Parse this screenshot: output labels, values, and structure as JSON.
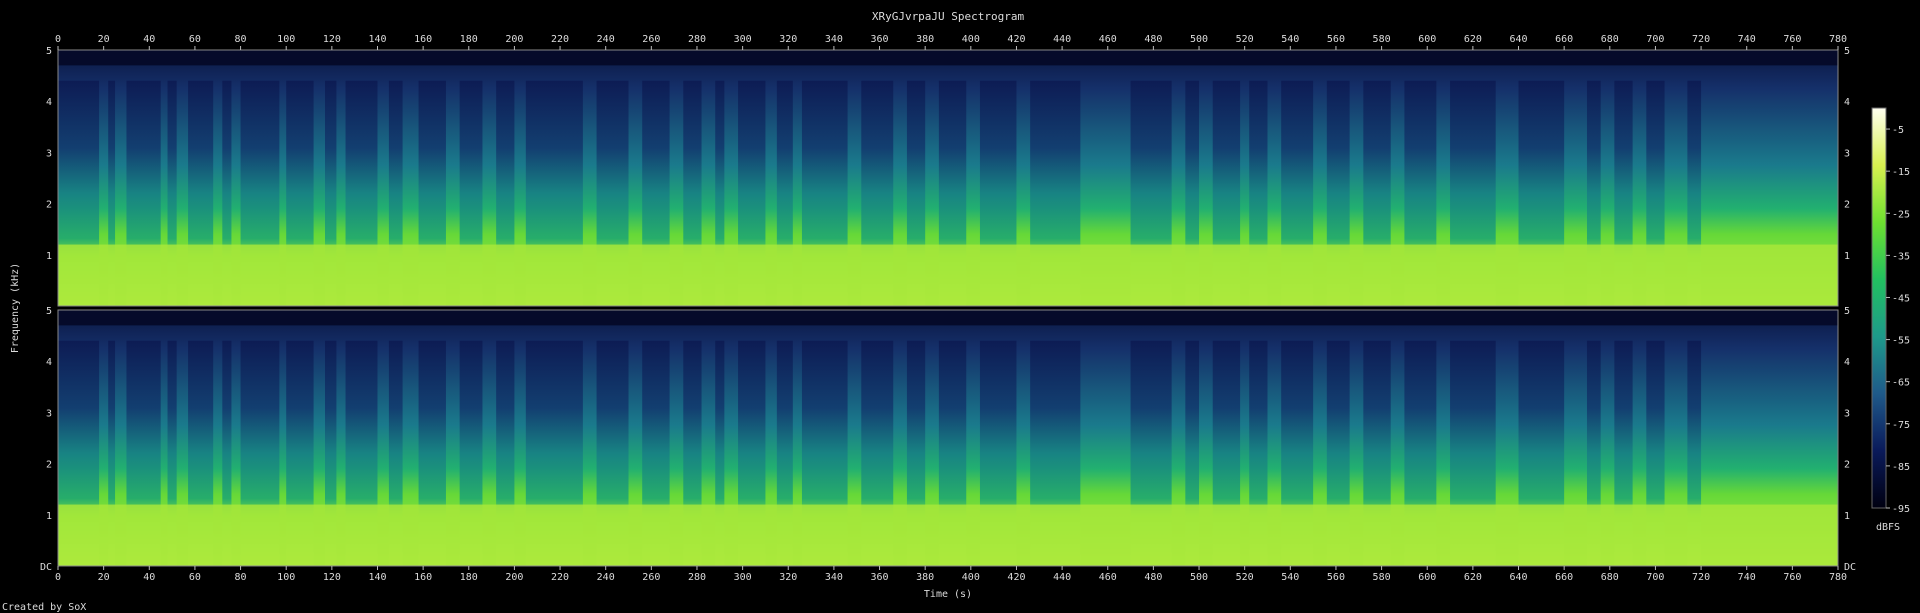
{
  "chart_data": {
    "type": "heatmap",
    "title": "XRyGJvrpaJU Spectrogram",
    "xlabel": "Time (s)",
    "ylabel": "Frequency (kHz)",
    "xlim": [
      0,
      780
    ],
    "ylim": [
      0,
      5
    ],
    "x_ticks": [
      "0",
      "20",
      "40",
      "60",
      "80",
      "100",
      "120",
      "140",
      "160",
      "180",
      "200",
      "220",
      "240",
      "260",
      "280",
      "300",
      "320",
      "340",
      "360",
      "380",
      "400",
      "420",
      "440",
      "460",
      "480",
      "500",
      "520",
      "540",
      "560",
      "580",
      "600",
      "620",
      "640",
      "660",
      "680",
      "700",
      "720",
      "740",
      "760",
      "780"
    ],
    "y_ticks_channel_top": [
      "5",
      "4",
      "3",
      "2",
      "1"
    ],
    "y_ticks_channel_bottom": [
      "5",
      "4",
      "3",
      "2",
      "1",
      "DC"
    ],
    "channels": 2,
    "colorbar": {
      "label": "dBFS",
      "ticks": [
        "-5",
        "-15",
        "-25",
        "-35",
        "-45",
        "-55",
        "-65",
        "-75",
        "-85",
        "-95"
      ],
      "range": [
        -95,
        0
      ],
      "stops": [
        "#000010",
        "#0a1a5a",
        "#1f5a8a",
        "#1e9a8a",
        "#22c060",
        "#6ee030",
        "#d8f050",
        "#fffff0"
      ]
    },
    "speech_segments_s": [
      [
        0,
        18
      ],
      [
        22,
        25
      ],
      [
        30,
        45
      ],
      [
        48,
        52
      ],
      [
        57,
        68
      ],
      [
        72,
        76
      ],
      [
        80,
        97
      ],
      [
        100,
        112
      ],
      [
        117,
        122
      ],
      [
        126,
        140
      ],
      [
        145,
        151
      ],
      [
        158,
        170
      ],
      [
        176,
        186
      ],
      [
        192,
        200
      ],
      [
        205,
        230
      ],
      [
        236,
        250
      ],
      [
        256,
        268
      ],
      [
        274,
        282
      ],
      [
        288,
        292
      ],
      [
        298,
        310
      ],
      [
        315,
        322
      ],
      [
        326,
        346
      ],
      [
        352,
        366
      ],
      [
        372,
        380
      ],
      [
        386,
        398
      ],
      [
        404,
        420
      ],
      [
        426,
        448
      ],
      [
        470,
        488
      ],
      [
        494,
        500
      ],
      [
        506,
        518
      ],
      [
        522,
        530
      ],
      [
        536,
        550
      ],
      [
        556,
        566
      ],
      [
        572,
        584
      ],
      [
        590,
        604
      ],
      [
        610,
        630
      ],
      [
        640,
        660
      ],
      [
        670,
        676
      ],
      [
        682,
        690
      ],
      [
        696,
        704
      ],
      [
        714,
        720
      ]
    ],
    "footer": "Created by SoX"
  }
}
